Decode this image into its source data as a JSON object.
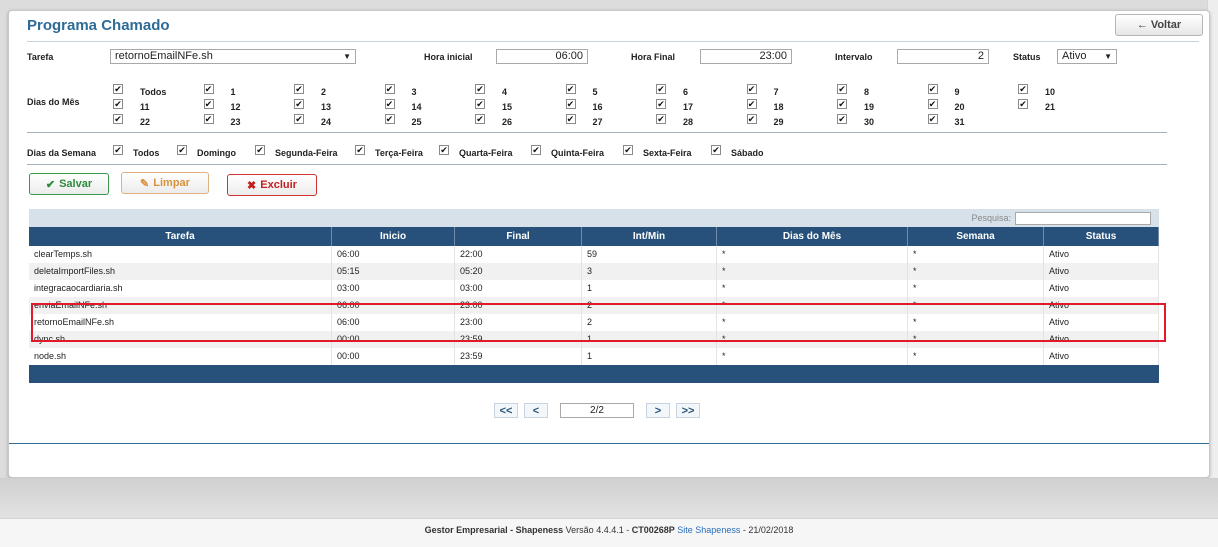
{
  "header": {
    "title": "Programa Chamado",
    "back_label": "Voltar"
  },
  "form": {
    "tarefa_label": "Tarefa",
    "tarefa_value": "retornoEmailNFe.sh",
    "hora_inicial_label": "Hora inicial",
    "hora_inicial_value": "06:00",
    "hora_final_label": "Hora Final",
    "hora_final_value": "23:00",
    "intervalo_label": "Intervalo",
    "intervalo_value": "2",
    "status_label": "Status",
    "status_value": "Ativo",
    "dias_mes_label": "Dias do Mês",
    "dias_semana_label": "Dias da Semana"
  },
  "days_of_month": [
    "Todos",
    "1",
    "2",
    "3",
    "4",
    "5",
    "6",
    "7",
    "8",
    "9",
    "10",
    "11",
    "12",
    "13",
    "14",
    "15",
    "16",
    "17",
    "18",
    "19",
    "20",
    "21",
    "22",
    "23",
    "24",
    "25",
    "26",
    "27",
    "28",
    "29",
    "30",
    "31"
  ],
  "days_of_week": [
    "Todos",
    "Domingo",
    "Segunda-Feira",
    "Terça-Feira",
    "Quarta-Feira",
    "Quinta-Feira",
    "Sexta-Feira",
    "Sábado"
  ],
  "buttons": {
    "salvar": "Salvar",
    "limpar": "Limpar",
    "excluir": "Excluir"
  },
  "table": {
    "search_label": "Pesquisa:",
    "columns": [
      "Tarefa",
      "Inicio",
      "Final",
      "Int/Min",
      "Dias do Mês",
      "Semana",
      "Status"
    ],
    "rows": [
      [
        "clearTemps.sh",
        "06:00",
        "22:00",
        "59",
        "*",
        "*",
        "Ativo"
      ],
      [
        "deletaImportFiles.sh",
        "05:15",
        "05:20",
        "3",
        "*",
        "*",
        "Ativo"
      ],
      [
        "integracaocardiaria.sh",
        "03:00",
        "03:00",
        "1",
        "*",
        "*",
        "Ativo"
      ],
      [
        "enviaEmailNFe.sh",
        "06:00",
        "23:00",
        "2",
        "*",
        "*",
        "Ativo"
      ],
      [
        "retornoEmailNFe.sh",
        "06:00",
        "23:00",
        "2",
        "*",
        "*",
        "Ativo"
      ],
      [
        "dync.sh",
        "00:00",
        "23:59",
        "1",
        "*",
        "*",
        "Ativo"
      ],
      [
        "node.sh",
        "00:00",
        "23:59",
        "1",
        "*",
        "*",
        "Ativo"
      ]
    ]
  },
  "pager": {
    "first": "<<",
    "prev": "<",
    "page": "2/2",
    "next": ">",
    "last": ">>"
  },
  "footer": {
    "app": "Gestor Empresarial - Shapeness",
    "version": "Versão 4.4.4.1 -",
    "code": "CT00268P",
    "link": "Site Shapeness",
    "date": "- 21/02/2018"
  },
  "colors": {
    "accent": "#2e6b97",
    "table_header": "#27517a",
    "highlight": "#e0192b",
    "salvar": "#2d8a3a",
    "limpar": "#d9913c",
    "excluir": "#c12020"
  }
}
